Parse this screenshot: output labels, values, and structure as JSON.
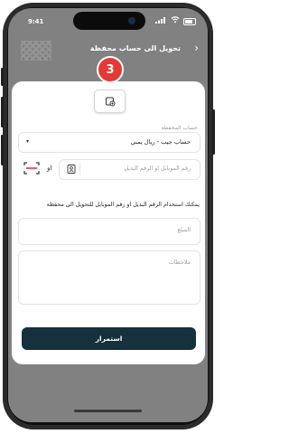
{
  "status_bar": {
    "time": "9:41"
  },
  "header": {
    "title": "تحويل الى حساب محفظة",
    "back_icon": "chevron-right-icon"
  },
  "step_badge": {
    "number": "3",
    "color": "#e53935"
  },
  "form": {
    "wallet_account": {
      "label": "حساب المحفظة",
      "value": "حساب جيب - ريال يمني"
    },
    "phone": {
      "placeholder": "رقم الموبايل او الرقم البديل",
      "or_label": "او"
    },
    "hint": "يمكنك استخدام الرقم البديل او رقم الموبايل للتحويل الى محفظة",
    "amount": {
      "placeholder": "المبلغ"
    },
    "notes": {
      "placeholder": "ملاحظات"
    }
  },
  "actions": {
    "continue_label": "استمرار",
    "button_color": "#14313d"
  }
}
